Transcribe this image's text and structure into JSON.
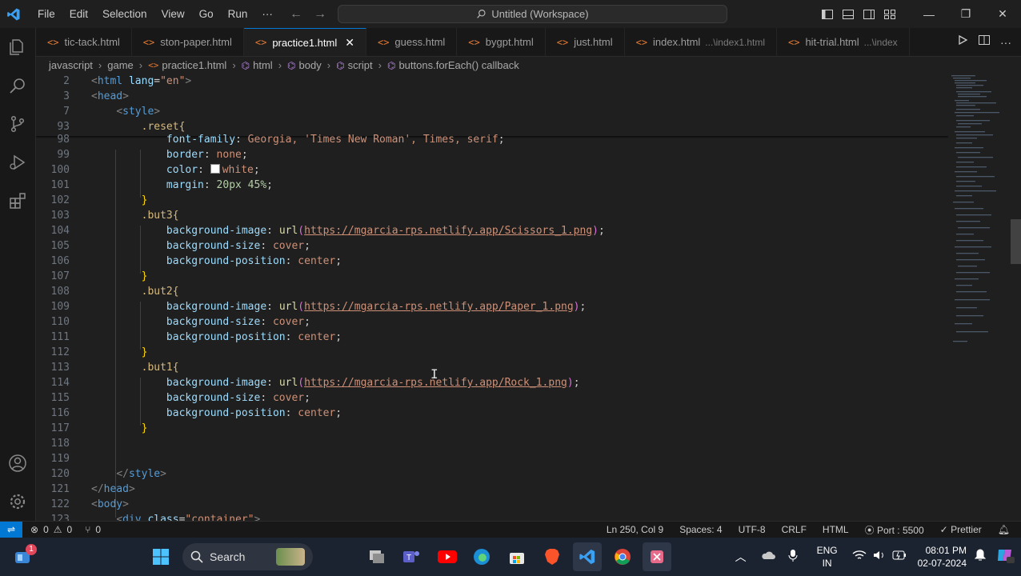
{
  "menu": [
    "File",
    "Edit",
    "Selection",
    "View",
    "Go",
    "Run",
    "···"
  ],
  "command_center": "Untitled (Workspace)",
  "tabs": [
    {
      "label": "tic-tack.html",
      "active": false
    },
    {
      "label": "ston-paper.html",
      "active": false
    },
    {
      "label": "practice1.html",
      "active": true
    },
    {
      "label": "guess.html",
      "active": false
    },
    {
      "label": "bygpt.html",
      "active": false
    },
    {
      "label": "just.html",
      "active": false
    },
    {
      "label": "index.html",
      "desc": "...\\index1.html",
      "active": false
    },
    {
      "label": "hit-trial.html",
      "desc": "...\\index",
      "active": false
    }
  ],
  "breadcrumb": [
    "javascript",
    "game",
    "practice1.html",
    "html",
    "body",
    "script",
    "buttons.forEach() callback"
  ],
  "lines": [
    "2",
    "3",
    "7",
    "93",
    "98",
    "99",
    "100",
    "101",
    "102",
    "103",
    "104",
    "105",
    "106",
    "107",
    "108",
    "109",
    "110",
    "111",
    "112",
    "113",
    "114",
    "115",
    "116",
    "117",
    "118",
    "119",
    "120",
    "121",
    "122",
    "123"
  ],
  "code": {
    "html_open": "html",
    "lang_attr": "lang",
    "lang_val": "\"en\"",
    "head": "head",
    "style": "style",
    "reset_sel": ".reset{",
    "ff_prop": "font-family",
    "ff_val": "Georgia, 'Times New Roman', Times, serif",
    "border_prop": "border",
    "border_val": "none",
    "color_prop": "color",
    "color_val": "white",
    "margin_prop": "margin",
    "margin_val": "20px 45%",
    "but3_sel": ".but3{",
    "but2_sel": ".but2{",
    "but1_sel": ".but1{",
    "bgimg_prop": "background-image",
    "bgsize_prop": "background-size",
    "bgpos_prop": "background-position",
    "url_fn": "url",
    "url_scissors": "https://mgarcia-rps.netlify.app/Scissors_1.png",
    "url_paper": "https://mgarcia-rps.netlify.app/Paper_1.png",
    "url_rock": "https://mgarcia-rps.netlify.app/Rock_1.png",
    "cover": "cover",
    "center": "center",
    "style_close": "style",
    "head_close": "head",
    "body_open": "body",
    "div_partial": "div",
    "class_attr": "class",
    "class_val": "\"container\""
  },
  "status": {
    "errors": "0",
    "warnings": "0",
    "ports": "0",
    "position": "Ln 250, Col 9",
    "spaces": "Spaces: 4",
    "encoding": "UTF-8",
    "eol": "CRLF",
    "language": "HTML",
    "port": "Port : 5500",
    "prettier": "Prettier"
  },
  "taskbar": {
    "search_label": "Search",
    "widget_badge": "1",
    "lang_line1": "ENG",
    "lang_line2": "IN",
    "time": "08:01 PM",
    "date": "02-07-2024"
  },
  "colors": {
    "accent": "#0078d4",
    "html_icon": "#e37933"
  }
}
